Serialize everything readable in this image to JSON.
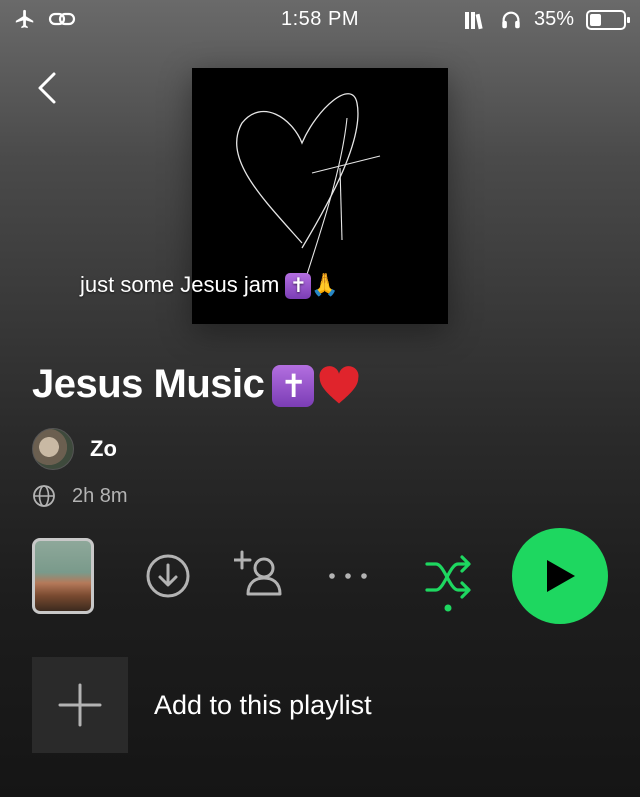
{
  "status_bar": {
    "time": "1:58 PM",
    "battery_percent": "35%",
    "battery_level": 0.35
  },
  "playlist": {
    "cover_caption": "just some Jesus jam",
    "title": "Jesus Music",
    "owner": "Zo",
    "duration": "2h 8m"
  },
  "add_to_playlist": {
    "label": "Add to this playlist"
  },
  "colors": {
    "accent_green": "#1ed760",
    "secondary_text": "#b3b3b3"
  },
  "icons": [
    "airplane-icon",
    "link-icon",
    "library-icon",
    "headphones-icon",
    "battery-icon",
    "back-icon",
    "globe-icon",
    "download-icon",
    "add-user-icon",
    "more-icon",
    "shuffle-icon",
    "play-icon",
    "plus-icon",
    "cross-emoji",
    "praying-hands-emoji",
    "heart-emoji"
  ]
}
